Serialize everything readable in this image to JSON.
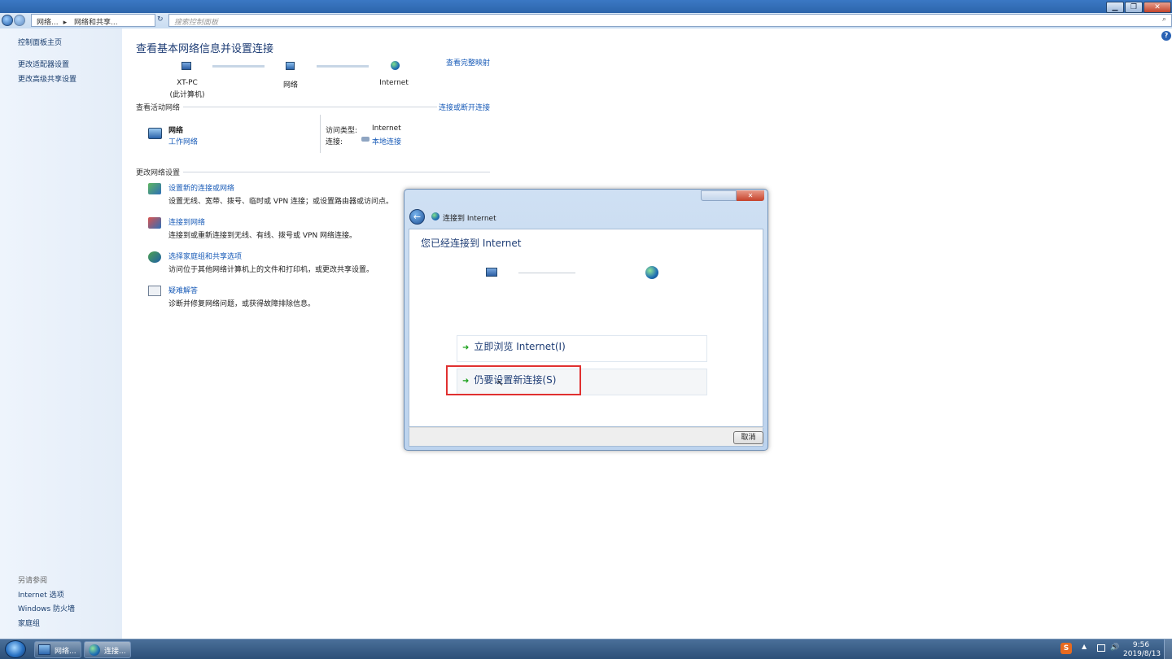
{
  "explorer": {
    "breadcrumb": [
      "网络...",
      "网络和共享..."
    ],
    "search_placeholder": "搜索控制面板",
    "window_controls": {
      "minimize": "▁",
      "maximize": "❐",
      "close": "✕"
    }
  },
  "sidebar": {
    "home": "控制面板主页",
    "items": [
      {
        "label": "更改适配器设置"
      },
      {
        "label": "更改高级共享设置"
      }
    ],
    "see_also_header": "另请参阅",
    "see_also": [
      {
        "label": "Internet 选项"
      },
      {
        "label": "Windows 防火墙"
      },
      {
        "label": "家庭组"
      }
    ]
  },
  "main": {
    "title": "查看基本网络信息并设置连接",
    "view_full_map": "查看完整映射",
    "map_nodes": [
      {
        "label": "XT-PC",
        "sublabel": "(此计算机)"
      },
      {
        "label": "网络",
        "sublabel": ""
      },
      {
        "label": "Internet",
        "sublabel": ""
      }
    ],
    "active_networks_header": "查看活动网络",
    "connect_disconnect": "连接或断开连接",
    "network": {
      "name": "网络",
      "type": "工作网络",
      "access_type_label": "访问类型:",
      "access_type_value": "Internet",
      "connection_label": "连接:",
      "connection_value": "本地连接"
    },
    "change_settings_header": "更改网络设置",
    "tasks": [
      {
        "title": "设置新的连接或网络",
        "desc": "设置无线、宽带、拨号、临时或 VPN 连接；或设置路由器或访问点。"
      },
      {
        "title": "连接到网络",
        "desc": "连接到或重新连接到无线、有线、拨号或 VPN 网络连接。"
      },
      {
        "title": "选择家庭组和共享选项",
        "desc": "访问位于其他网络计算机上的文件和打印机，或更改共享设置。"
      },
      {
        "title": "疑难解答",
        "desc": "诊断并修复网络问题，或获得故障排除信息。"
      }
    ]
  },
  "dialog": {
    "title": "连接到 Internet",
    "heading": "您已经连接到 Internet",
    "options": [
      {
        "label": "立即浏览 Internet(I)"
      },
      {
        "label": "仍要设置新连接(S)"
      }
    ],
    "cancel": "取消",
    "highlight_color": "#e03030"
  },
  "taskbar": {
    "buttons": [
      {
        "label": "网络..."
      },
      {
        "label": "连接..."
      }
    ],
    "time": "9:56",
    "date": "2019/8/13",
    "tray_ime": "S"
  }
}
